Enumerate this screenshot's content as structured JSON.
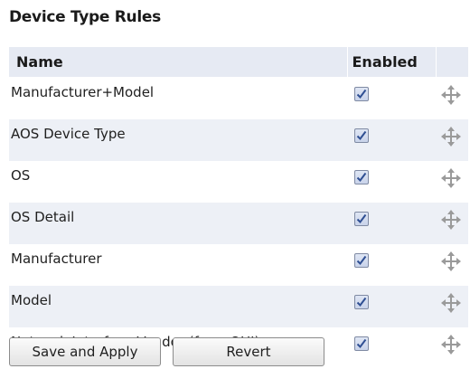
{
  "section": {
    "title": "Device Type Rules"
  },
  "table": {
    "headers": {
      "name": "Name",
      "enabled": "Enabled"
    },
    "rows": [
      {
        "name": "Manufacturer+Model",
        "enabled": true
      },
      {
        "name": "AOS Device Type",
        "enabled": true
      },
      {
        "name": "OS",
        "enabled": true
      },
      {
        "name": "OS Detail",
        "enabled": true
      },
      {
        "name": "Manufacturer",
        "enabled": true
      },
      {
        "name": "Model",
        "enabled": true
      },
      {
        "name": "Network Interface Vendor (from OUI)",
        "enabled": true
      }
    ],
    "drag_icon": "move-arrows-icon"
  },
  "buttons": {
    "save_label": "Save and Apply",
    "revert_label": "Revert"
  },
  "colors": {
    "header_bg": "#e6eaf3",
    "stripe_bg": "#edf0f6",
    "checkmark": "#2f4f93"
  }
}
